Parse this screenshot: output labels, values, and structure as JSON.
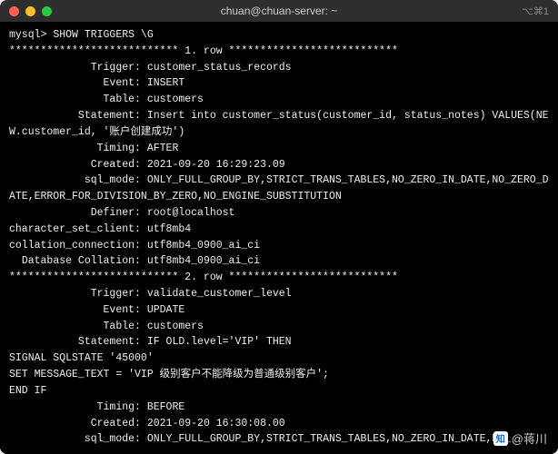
{
  "window": {
    "title": "chuan@chuan-server: ~",
    "right_indicator": "⌥⌘1"
  },
  "terminal": {
    "prompt": "mysql> ",
    "command": "SHOW TRIGGERS \\G",
    "sep1": "*************************** 1. row ***************************",
    "row1": {
      "Trigger": "customer_status_records",
      "Event": "INSERT",
      "Table": "customers",
      "Statement": "Insert into customer_status(customer_id, status_notes) VALUES(NEW.customer_id, '账户创建成功')",
      "Timing": "AFTER",
      "Created": "2021-09-20 16:29:23.09",
      "sql_mode": "ONLY_FULL_GROUP_BY,STRICT_TRANS_TABLES,NO_ZERO_IN_DATE,NO_ZERO_DATE,ERROR_FOR_DIVISION_BY_ZERO,NO_ENGINE_SUBSTITUTION",
      "Definer": "root@localhost",
      "character_set_client": "utf8mb4",
      "collation_connection": "utf8mb4_0900_ai_ci",
      "Database_Collation": "utf8mb4_0900_ai_ci"
    },
    "sep2": "*************************** 2. row ***************************",
    "row2": {
      "Trigger": "validate_customer_level",
      "Event": "UPDATE",
      "Table": "customers",
      "Statement": "IF OLD.level='VIP' THEN\nSIGNAL SQLSTATE '45000'\nSET MESSAGE_TEXT = 'VIP 级别客户不能降级为普通级别客户';\nEND IF",
      "Timing": "BEFORE",
      "Created": "2021-09-20 16:30:08.00",
      "sql_mode": "ONLY_FULL_GROUP_BY,STRICT_TRANS_TABLES,NO_ZERO_IN_DATE,NO_"
    }
  },
  "watermark": {
    "logo": "知",
    "text": "@蒋川"
  }
}
